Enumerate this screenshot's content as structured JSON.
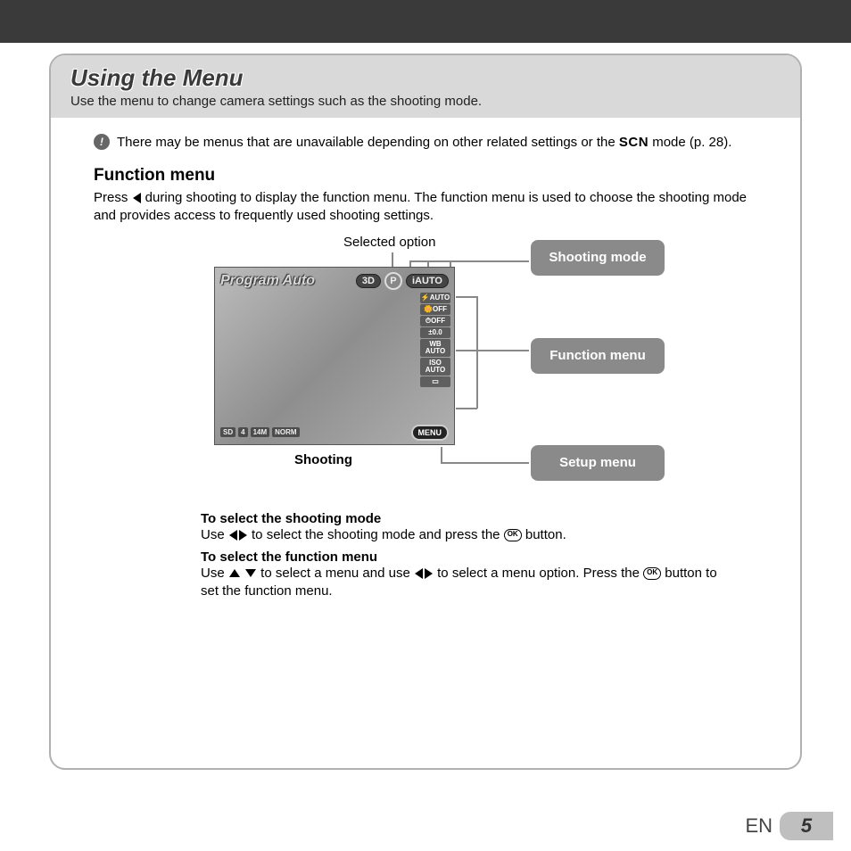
{
  "header": {
    "title": "Using the Menu",
    "subtitle": "Use the menu to change camera settings such as the shooting mode."
  },
  "note": {
    "text_before": "There may be menus that are unavailable depending on other related settings or the ",
    "scn": "SCN",
    "text_after": " mode (p. 28)."
  },
  "section": {
    "heading": "Function menu",
    "body_before": "Press ",
    "body_after": " during shooting to display the function menu. The function menu is used to choose the shooting mode and provides access to frequently used shooting settings."
  },
  "diagram": {
    "selected_option_label": "Selected option",
    "shooting_label": "Shooting",
    "callouts": {
      "shooting_mode": "Shooting mode",
      "function_menu": "Function menu",
      "setup_menu": "Setup menu"
    },
    "screen": {
      "mode_name": "Program Auto",
      "top_pills": [
        "3D",
        "P",
        "iAUTO"
      ],
      "side_items": [
        "⚡AUTO",
        "🌼OFF",
        "⏱OFF",
        "±0.0",
        "WB AUTO",
        "ISO AUTO",
        "▭"
      ],
      "bottom_badges": [
        "SD",
        "4",
        "14M",
        "NORM"
      ],
      "menu_button": "MENU"
    }
  },
  "instructions": {
    "s1_title": "To select the shooting mode",
    "s1_body_a": "Use ",
    "s1_body_b": " to select the shooting mode and press the ",
    "s1_body_c": " button.",
    "s2_title": "To select the function menu",
    "s2_body_a": "Use ",
    "s2_body_b": " to select a menu and use ",
    "s2_body_c": " to select a menu option. Press the ",
    "s2_body_d": " button to set the function menu.",
    "ok_label": "OK"
  },
  "footer": {
    "lang": "EN",
    "page": "5"
  }
}
